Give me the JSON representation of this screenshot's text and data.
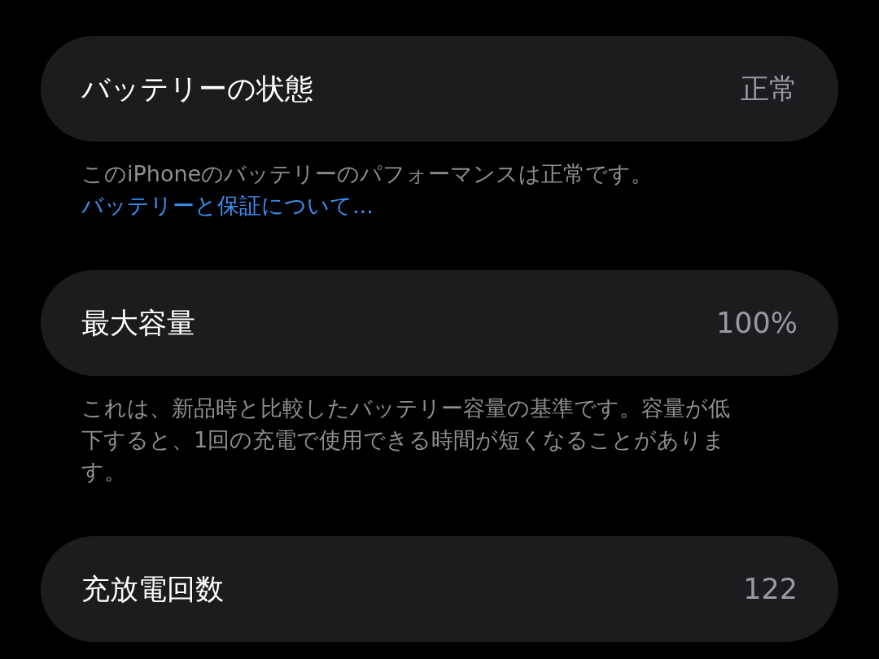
{
  "rows": [
    {
      "label": "バッテリーの状態",
      "value": "正常",
      "footer": {
        "text": "このiPhoneのバッテリーのパフォーマンスは正常です。",
        "link": "バッテリーと保証について..."
      }
    },
    {
      "label": "最大容量",
      "value": "100%",
      "footer": {
        "text": "これは、新品時と比較したバッテリー容量の基準です。容量が低下すると、1回の充電で使用できる時間が短くなることがあります。"
      }
    },
    {
      "label": "充放電回数",
      "value": "122"
    }
  ]
}
